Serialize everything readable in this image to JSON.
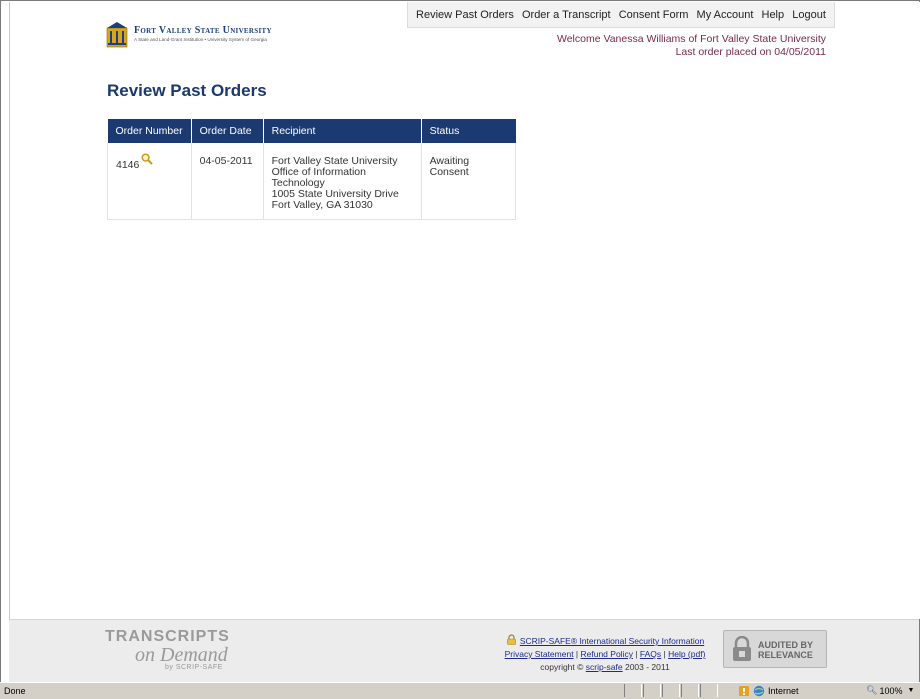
{
  "header": {
    "logo_name": "Fort Valley State University",
    "logo_tagline": "A State and Land-Grant Institution • University System of Georgia"
  },
  "nav": {
    "items": [
      "Review Past Orders",
      "Order a Transcript",
      "Consent Form",
      "My Account",
      "Help",
      "Logout"
    ]
  },
  "welcome": {
    "line1": "Welcome Vanessa Williams of Fort Valley State University",
    "line2": "Last order placed on 04/05/2011"
  },
  "page": {
    "title": "Review Past Orders"
  },
  "orders": {
    "columns": [
      "Order Number",
      "Order Date",
      "Recipient",
      "Status"
    ],
    "rows": [
      {
        "order_number": "4146",
        "order_date": "04-05-2011",
        "recipient": [
          "Fort Valley State University",
          "Office of Information Technology",
          "1005 State University Drive",
          "Fort Valley, GA 31030"
        ],
        "status": "Awaiting Consent"
      }
    ]
  },
  "footer": {
    "brand_line1": "TRANSCRIPTS",
    "brand_line2": "on Demand",
    "brand_line3": "by SCRIP-SAFE",
    "security_link": "SCRIP-SAFE® International Security Information",
    "privacy_link": "Privacy Statement",
    "refund_link": "Refund Policy",
    "faqs_link": "FAQs",
    "help_link": "Help (pdf)",
    "copyright_prefix": "copyright © ",
    "copyright_link": "scrip-safe",
    "copyright_suffix": " 2003 - 2011",
    "audit_line1": "AUDITED BY",
    "audit_line2": "RELEVANCE"
  },
  "statusbar": {
    "left": "Done",
    "zone": "Internet",
    "zoom": "100%"
  },
  "colors": {
    "header_blue": "#1c3a72",
    "welcome_text": "#7a2a4a",
    "link_blue": "#1c2a8e"
  }
}
